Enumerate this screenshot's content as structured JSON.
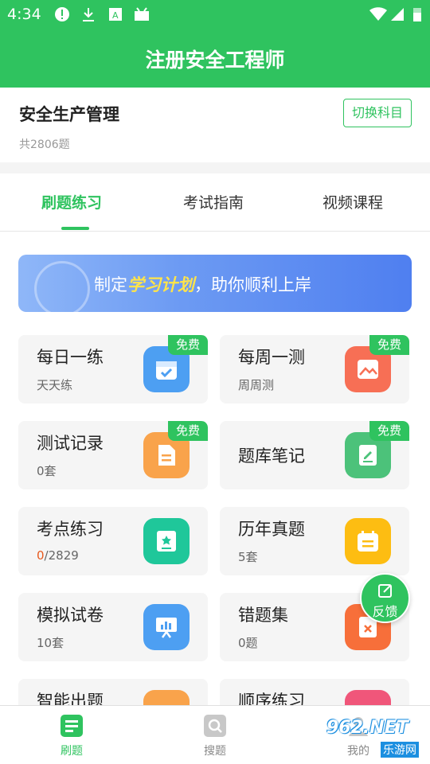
{
  "status_bar": {
    "time": "4:34"
  },
  "header": {
    "title": "注册安全工程师"
  },
  "subject": {
    "name": "安全生产管理",
    "count": "共2806题",
    "switch_label": "切换科目"
  },
  "tabs": [
    {
      "label": "刷题练习",
      "active": true
    },
    {
      "label": "考试指南",
      "active": false
    },
    {
      "label": "视频课程",
      "active": false
    }
  ],
  "banner": {
    "prefix": "制定",
    "highlight": "学习计划",
    "suffix": "，助你顺利上岸"
  },
  "cards": [
    {
      "title": "每日一练",
      "sub": "天天练",
      "badge": "免费",
      "icon": "calendar-check-icon",
      "color": "#4d9ff2"
    },
    {
      "title": "每周一测",
      "sub": "周周测",
      "badge": "免费",
      "icon": "chart-image-icon",
      "color": "#f76f55"
    },
    {
      "title": "测试记录",
      "sub": "0套",
      "badge": "免费",
      "icon": "document-icon",
      "color": "#f9a34b"
    },
    {
      "title": "题库笔记",
      "sub": "",
      "badge": "免费",
      "icon": "note-pen-icon",
      "color": "#4cc27a"
    },
    {
      "title": "考点练习",
      "sub_red": "0",
      "sub_rest": "/2829",
      "badge": "",
      "icon": "star-board-icon",
      "color": "#1fc79a"
    },
    {
      "title": "历年真题",
      "sub": "5套",
      "badge": "",
      "icon": "calendar-list-icon",
      "color": "#fdbd12"
    },
    {
      "title": "模拟试卷",
      "sub": "10套",
      "badge": "",
      "icon": "presentation-chart-icon",
      "color": "#4d9ff2"
    },
    {
      "title": "错题集",
      "sub": "0题",
      "badge": "",
      "icon": "error-book-icon",
      "color": "#f76f3a"
    },
    {
      "title": "智能出题",
      "sub": "",
      "badge": "",
      "icon": "smart-icon",
      "color": "#f9a34b"
    },
    {
      "title": "顺序练习",
      "sub": "",
      "badge": "",
      "icon": "sequence-icon",
      "color": "#f0567a"
    }
  ],
  "feedback": {
    "label": "反馈"
  },
  "bottom_nav": [
    {
      "label": "刷题",
      "icon": "practice-icon",
      "active": true
    },
    {
      "label": "搜题",
      "icon": "search-icon",
      "active": false
    },
    {
      "label": "我的",
      "icon": "profile-icon",
      "active": false
    }
  ],
  "watermark": {
    "text": "962.NET",
    "sub": "乐游网"
  },
  "colors": {
    "brand": "#2fc35f",
    "accent_red": "#e75a1e"
  }
}
